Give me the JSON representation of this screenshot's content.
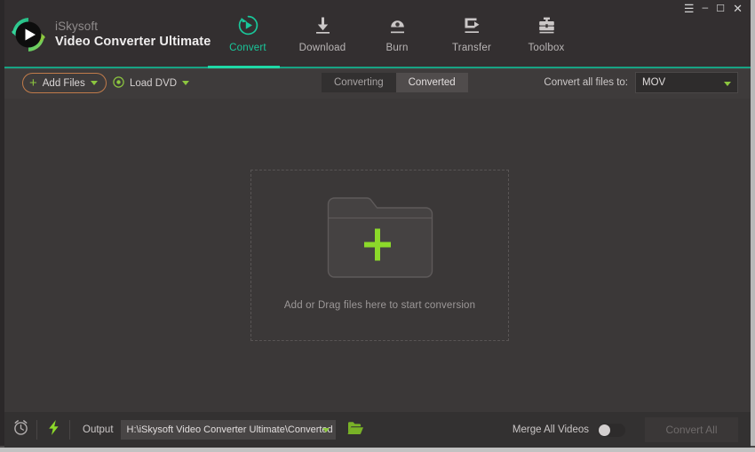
{
  "window": {
    "controls": [
      {
        "name": "menu",
        "glyph": "☰"
      },
      {
        "name": "minimize",
        "glyph": "–"
      },
      {
        "name": "maximize",
        "glyph": "☐"
      },
      {
        "name": "close",
        "glyph": "✕"
      }
    ]
  },
  "brand": {
    "line1": "iSkysoft",
    "line2": "Video Converter Ultimate",
    "logo_icon": "play-circle-refresh-logo",
    "accent_green": "#19c79a",
    "accent_lime": "#8cc63f"
  },
  "nav": {
    "items": [
      {
        "label": "Convert",
        "icon": "convert-icon",
        "active": true
      },
      {
        "label": "Download",
        "icon": "download-icon",
        "active": false
      },
      {
        "label": "Burn",
        "icon": "burn-disc-icon",
        "active": false
      },
      {
        "label": "Transfer",
        "icon": "transfer-icon",
        "active": false
      },
      {
        "label": "Toolbox",
        "icon": "toolbox-icon",
        "active": false
      }
    ]
  },
  "toolbar": {
    "add_files_label": "Add Files",
    "add_files_icon": "plus-icon",
    "add_files_caret": "chevron-down-icon",
    "load_dvd_label": "Load DVD",
    "load_dvd_icon": "disc-icon",
    "load_dvd_caret": "chevron-down-icon",
    "tabs": [
      {
        "label": "Converting",
        "active": true
      },
      {
        "label": "Converted",
        "active": false
      }
    ],
    "convert_all_to_label": "Convert all files to:",
    "convert_all_to_value": "MOV",
    "convert_all_to_caret": "chevron-down-icon"
  },
  "dropzone": {
    "icon": "folder-plus-icon",
    "text": "Add or Drag files here to start conversion"
  },
  "bottom": {
    "timer_icon": "alarm-clock-icon",
    "accel_icon": "lightning-bolt-icon",
    "output_label": "Output",
    "output_path": "H:\\iSkysoft Video Converter Ultimate\\Converted",
    "output_caret": "chevron-down-icon",
    "open_folder_icon": "folder-open-icon",
    "merge_label": "Merge All Videos",
    "merge_enabled": false,
    "convert_all_button": "Convert All"
  }
}
